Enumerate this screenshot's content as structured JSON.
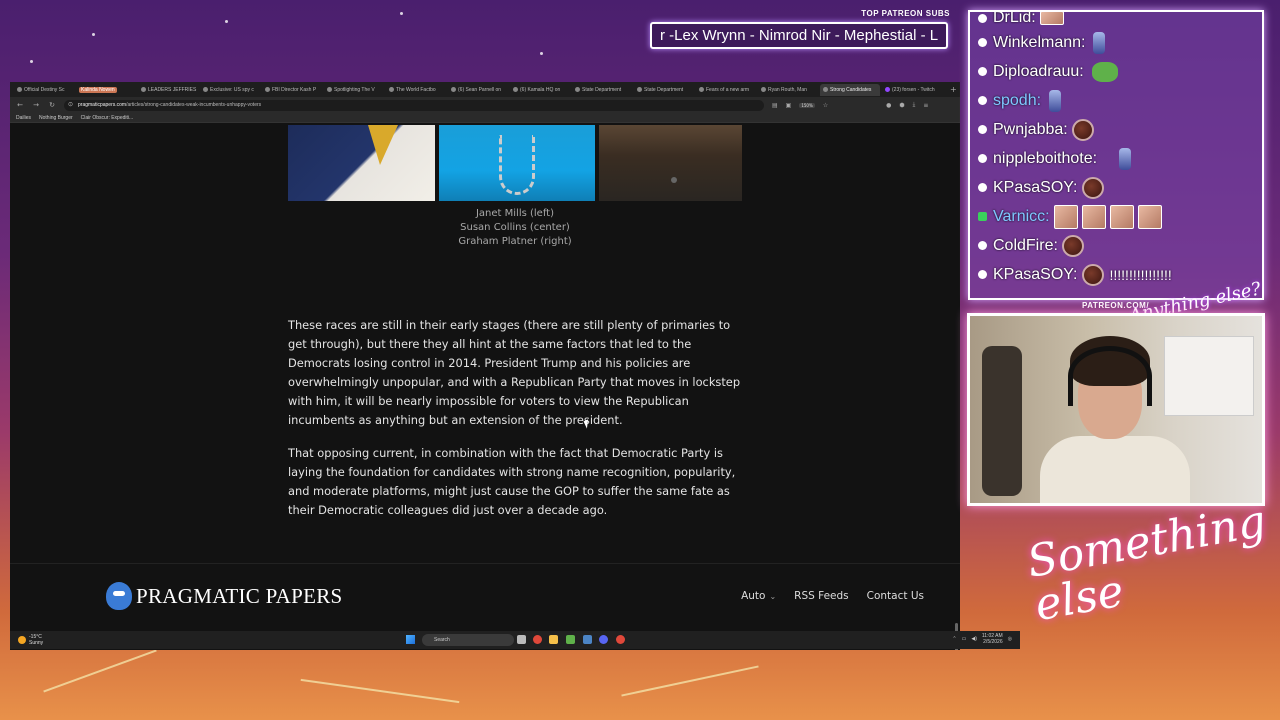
{
  "overlay": {
    "patreon_label": "TOP PATREON SUBS",
    "ticker_text": "r -Lex Wrynn - Nimrod Nir - Mephestial - L",
    "patreon_com": "PATREON.COM/",
    "anything_else": "Anything else?",
    "something_else": "Something else"
  },
  "browser": {
    "tabs": [
      {
        "label": "Official Destiny Sc"
      },
      {
        "label": "Kalinda Nowen",
        "highlight": true
      },
      {
        "label": "LEADERS JEFFRIES"
      },
      {
        "label": "Exclusive: US spy c"
      },
      {
        "label": "FBI Director Kash P"
      },
      {
        "label": "Spotlighting The V"
      },
      {
        "label": "The World Factbo"
      },
      {
        "label": "(6) Sean Parnell on"
      },
      {
        "label": "(6) Kamala HQ on"
      },
      {
        "label": "State Department"
      },
      {
        "label": "State Department"
      },
      {
        "label": "Fears of a new arm"
      },
      {
        "label": "Ryan Routh, Man"
      },
      {
        "label": "Strong Candidates",
        "active": true
      },
      {
        "label": "(23) forsen - Twitch"
      }
    ],
    "url_host": "pragmaticpapers.com",
    "url_path": "/articles/strong-candidates-weak-incumbents-unhappy-voters",
    "zoom": "150%",
    "bookmarks": [
      "Dailies",
      "Nothing Burger",
      "Clair Obscur: Expediti..."
    ]
  },
  "article": {
    "caption": [
      "Janet Mills (left)",
      "Susan Collins (center)",
      "Graham Platner (right)"
    ],
    "paragraphs": [
      "These races are still in their early stages (there are still plenty of primaries to get through), but there they all hint at the same factors that led to the Democrats losing control in 2014. President Trump and his policies are overwhelmingly unpopular, and with a Republican Party that moves in lockstep with him, it will be nearly impossible for voters to view the Republican incumbents as anything but an extension of the president.",
      "That opposing current, in combination with the fact that Democratic Party is laying the foundation for candidates with strong name recognition, popularity, and moderate platforms, might just cause the GOP to suffer the same fate as their Democratic colleagues did just over a decade ago."
    ]
  },
  "footer": {
    "logo_text": "PRAGMATIC PAPERS",
    "nav": {
      "theme": "Auto",
      "rss": "RSS Feeds",
      "contact": "Contact Us"
    }
  },
  "taskbar": {
    "weather_temp": "-15°C",
    "weather_desc": "Sunny",
    "search": "Search",
    "time": "11:02 AM",
    "date": "2/5/2026"
  },
  "chat": [
    {
      "name": "DrLid:",
      "emote": "face"
    },
    {
      "name": "Winkelmann:",
      "emote": "legs"
    },
    {
      "name": "Diploadrauu:",
      "emote": "pepe"
    },
    {
      "name": "spodh:",
      "emote": "legs",
      "color": "blue"
    },
    {
      "name": "Pwnjabba:",
      "emote": "blunt"
    },
    {
      "name": "nippleboithote:",
      "emote": "legs"
    },
    {
      "name": "KPasaSOY:",
      "emote": "blunt"
    },
    {
      "name": "Varnicc:",
      "emote": "face4",
      "color": "blue",
      "badge": "green"
    },
    {
      "name": "ColdFire:",
      "emote": "blunt"
    },
    {
      "name": "KPasaSOY:",
      "emote": "blunt",
      "extra": "!!!!!!!!!!!!!!!!"
    }
  ]
}
